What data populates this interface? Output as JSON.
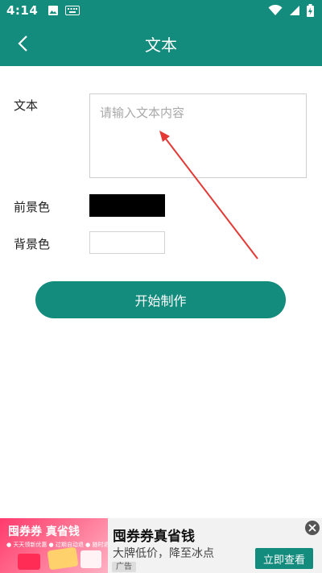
{
  "status_bar": {
    "time": "4:14",
    "icons": [
      "image-icon",
      "keyboard-icon",
      "wifi-icon",
      "signal-icon",
      "battery-charging-icon"
    ]
  },
  "app_bar": {
    "title": "文本",
    "back_icon": "chevron-left-icon"
  },
  "form": {
    "text_label": "文本",
    "text_placeholder": "请输入文本内容",
    "foreground_label": "前景色",
    "foreground_color": "#000000",
    "background_label": "背景色",
    "background_color": "#ffffff"
  },
  "actions": {
    "start_button": "开始制作"
  },
  "ad": {
    "image_title": "囤券券 真省钱",
    "image_caption": "● 天天领新优惠  ● 过期自动退  ● 随时退",
    "title": "囤券券真省钱",
    "subtitle": "大牌低价，降至冰点",
    "badge": "广告",
    "cta": "立即查看"
  },
  "colors": {
    "brand": "#138b7d",
    "annotation_arrow": "#e53935"
  }
}
